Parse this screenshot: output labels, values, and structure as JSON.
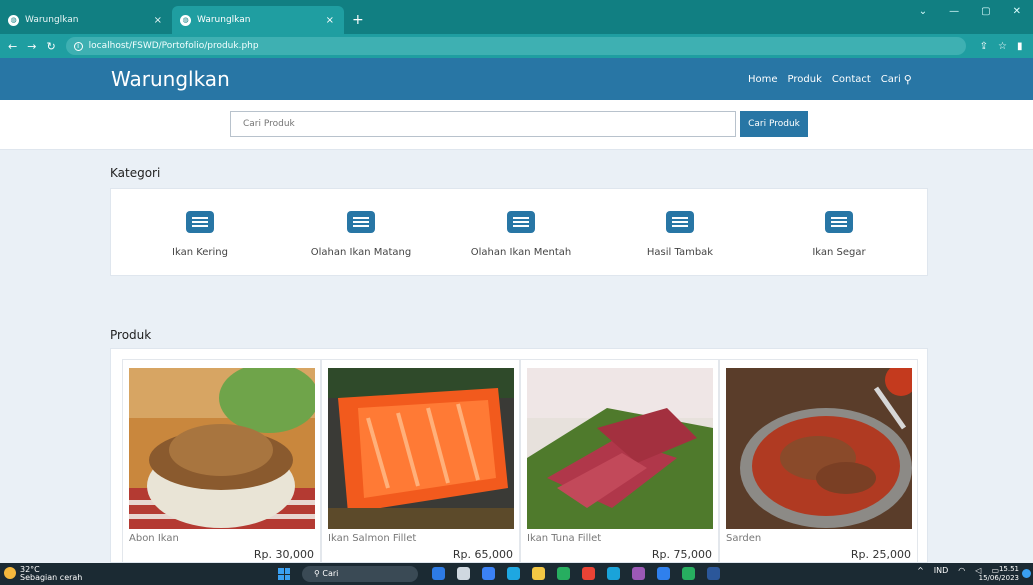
{
  "browser": {
    "tabs": [
      {
        "title": "Warunglkan",
        "close": "×"
      },
      {
        "title": "Warunglkan",
        "close": "×"
      }
    ],
    "newtab": "+",
    "url": "localhost/FSWD/Portofolio/produk.php",
    "window_controls": {
      "minimize": "—",
      "maximize": "▢",
      "close": "✕"
    }
  },
  "navbar": {
    "brand": "Warunglkan",
    "menu": {
      "home": "Home",
      "produk": "Produk",
      "contact": "Contact",
      "cari": "Cari"
    }
  },
  "search": {
    "placeholder": "Cari Produk",
    "button": "Cari Produk"
  },
  "kategori": {
    "title": "Kategori",
    "items": [
      {
        "label": "Ikan Kering"
      },
      {
        "label": "Olahan Ikan Matang"
      },
      {
        "label": "Olahan Ikan Mentah"
      },
      {
        "label": "Hasil Tambak"
      },
      {
        "label": "Ikan Segar"
      }
    ]
  },
  "produk": {
    "title": "Produk",
    "items": [
      {
        "name": "Abon Ikan",
        "price": "Rp. 30,000"
      },
      {
        "name": "Ikan Salmon Fillet",
        "price": "Rp. 65,000"
      },
      {
        "name": "Ikan Tuna Fillet",
        "price": "Rp. 75,000"
      },
      {
        "name": "Sarden",
        "price": "Rp. 25,000"
      }
    ]
  },
  "taskbar": {
    "temp": "32°C",
    "weather": "Sebagian cerah",
    "search": "Cari",
    "lang": "IND",
    "time": "15.51",
    "date": "15/06/2023"
  },
  "colors": {
    "primary": "#2876a5",
    "chrome": "#117f82"
  }
}
